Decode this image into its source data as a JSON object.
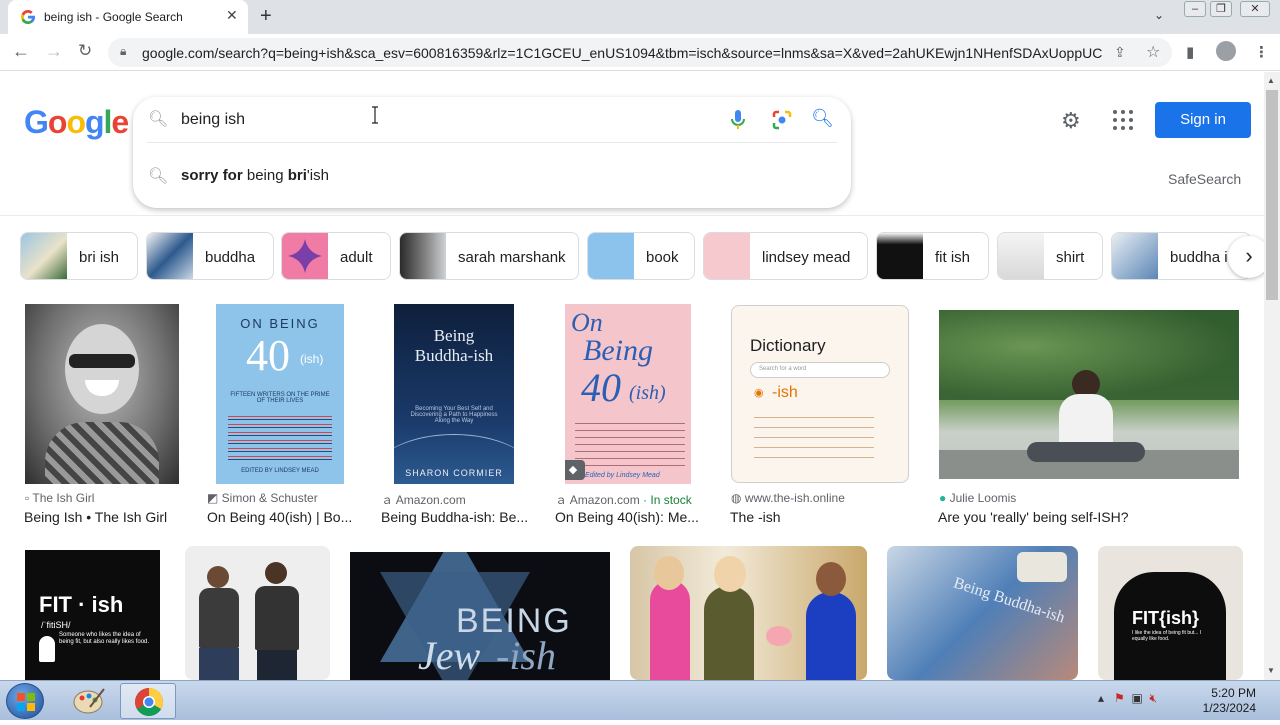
{
  "browser": {
    "tab_title": "being ish - Google Search",
    "url": "google.com/search?q=being+ish&sca_esv=600816359&rlz=1C1GCEU_enUS1094&tbm=isch&source=lnms&sa=X&ved=2ahUKEwjn1NHenfSDAxUoppUC..."
  },
  "search": {
    "query": "being ish",
    "suggestion_bold_1": "sorry for",
    "suggestion_mid": " being ",
    "suggestion_bold_2": "bri",
    "suggestion_end": "'ish"
  },
  "header": {
    "signin_label": "Sign in",
    "safesearch_label": "SafeSearch"
  },
  "chips": [
    {
      "label": "bri ish"
    },
    {
      "label": "buddha"
    },
    {
      "label": "adult"
    },
    {
      "label": "sarah marshank"
    },
    {
      "label": "book"
    },
    {
      "label": "lindsey mead"
    },
    {
      "label": "fit ish"
    },
    {
      "label": "shirt"
    },
    {
      "label": "buddha i"
    }
  ],
  "results": [
    {
      "source": "The Ish Girl",
      "title": "Being Ish • The Ish Girl"
    },
    {
      "source": "Simon & Schuster",
      "title": "On Being 40(ish) | Bo..."
    },
    {
      "source": "Amazon.com",
      "title": "Being Buddha-ish: Be..."
    },
    {
      "source": "Amazon.com",
      "stock": " · In stock",
      "title": "On Being 40(ish): Me..."
    },
    {
      "source": "www.the-ish.online",
      "title": "The -ish"
    },
    {
      "source": "Julie Loomis",
      "title": "Are you 'really' being self-ISH?"
    }
  ],
  "images": {
    "book1_top": "ON BEING",
    "book1_num": "40",
    "book1_ish": "(ish)",
    "book1_sub": "FIFTEEN WRITERS ON THE PRIME OF THEIR LIVES",
    "book1_author": "EDITED BY LINDSEY MEAD",
    "book2_title_1": "Being",
    "book2_title_2": "Buddha-ish",
    "book2_sub": "Becoming Your Best Self and Discovering a Path to Happiness Along the Way",
    "book2_author": "SHARON CORMIER",
    "book3_title_1": "On",
    "book3_title_2": "Being",
    "book3_title_3": "40",
    "book3_ish": "(ish)",
    "book3_author": "Edited by Lindsey Mead",
    "dict_title": "Dictionary",
    "dict_search": "Search for a word",
    "dict_word": "-ish",
    "fit_title": "FIT · ish",
    "fit_pron": "/ˈfitiSH/",
    "fit_def": "Someone who likes the idea of being fit, but also really likes food.",
    "jew_text_1": "BEING",
    "jew_text_2": "Jew",
    "jew_text_3": "-ish",
    "bb_text": "Being Buddha-ish",
    "tank_text": "FIT{ish}",
    "tank_sub": "I like the idea of being fit but... I equally like food."
  },
  "taskbar": {
    "time": "5:20 PM",
    "date": "1/23/2024"
  },
  "colors": {
    "google_blue": "#4285F4",
    "google_red": "#EA4335",
    "google_yellow": "#FBBC05",
    "google_green": "#34A853",
    "signin_bg": "#1a73e8"
  }
}
